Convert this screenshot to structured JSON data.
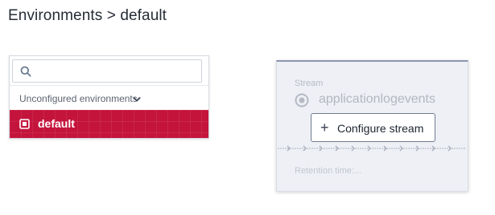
{
  "breadcrumb": "Environments > default",
  "search": {
    "placeholder": "",
    "value": "",
    "icon": "search-icon"
  },
  "filter": {
    "label": "Unconfigured environments",
    "icon": "chevron-down-icon"
  },
  "environments": [
    {
      "label": "default",
      "selected": true,
      "icon": "environment-icon"
    }
  ],
  "stream_card": {
    "caption": "Stream",
    "stream_name": "applicationlogevents",
    "configure_label": "Configure stream",
    "retention_label": "Retention time:..."
  },
  "colors": {
    "accent": "#c4143c",
    "card_border_top": "#8a96ad",
    "card_background": "#eef0f5"
  }
}
